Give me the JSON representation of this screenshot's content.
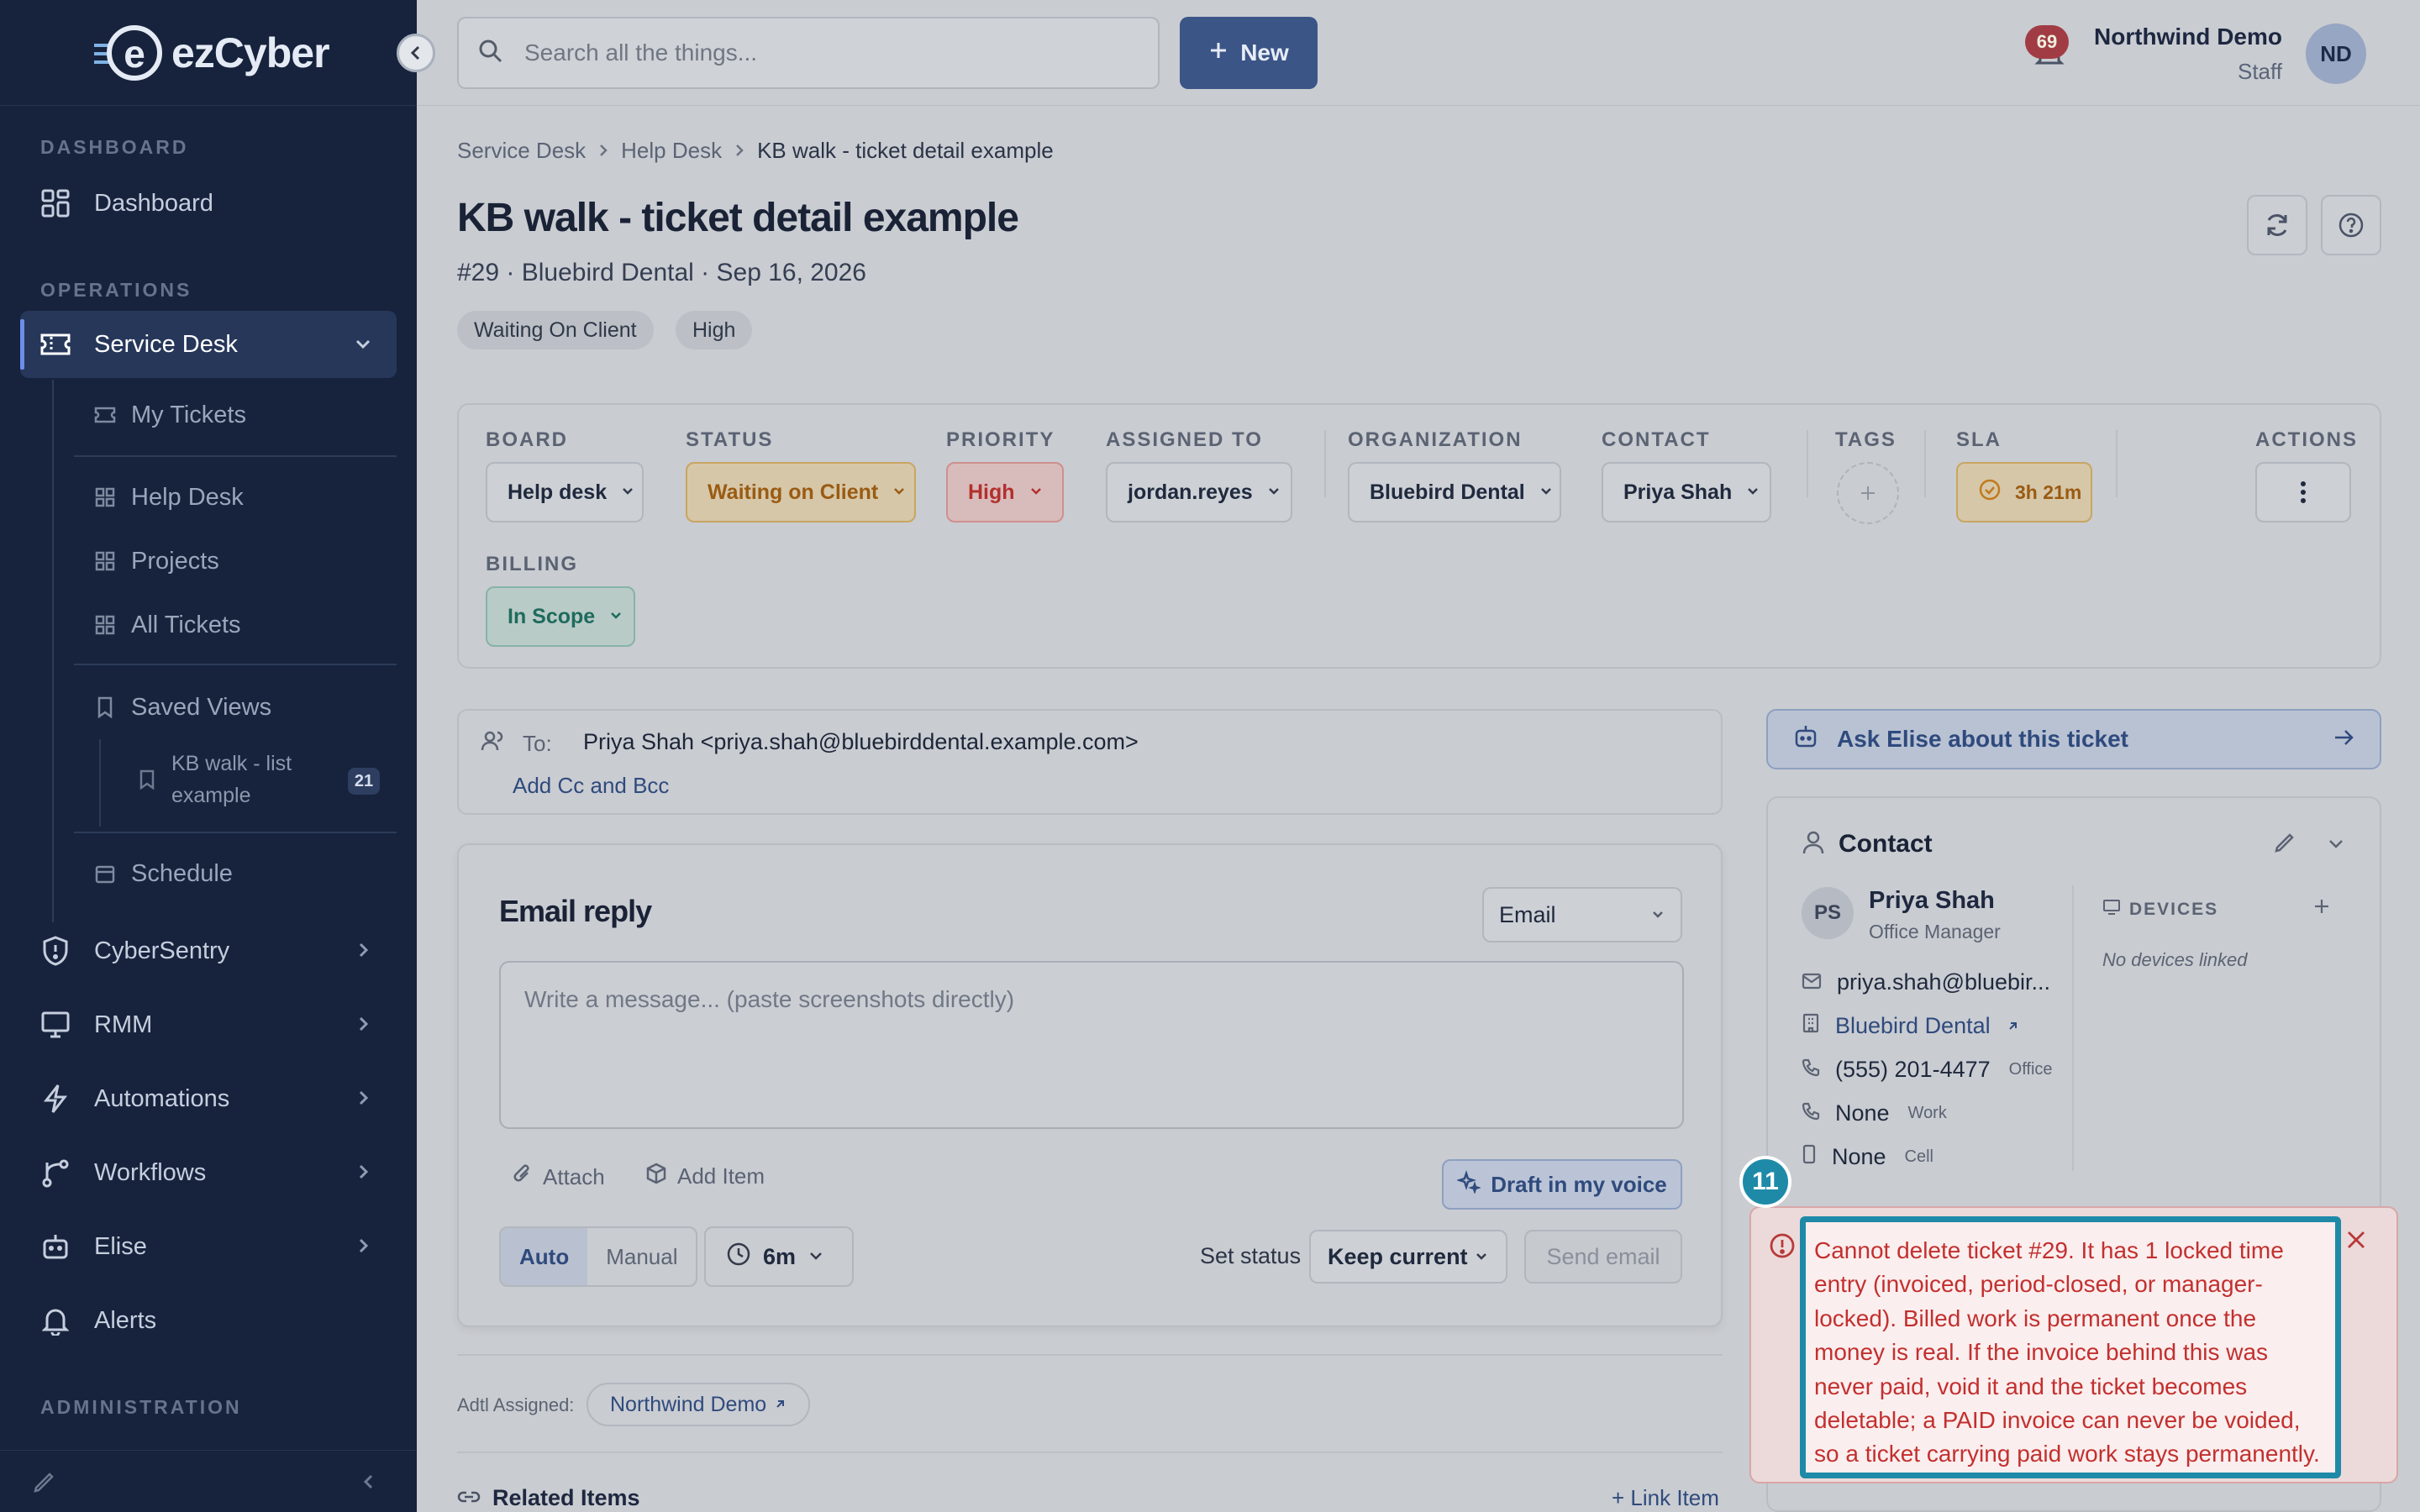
{
  "brand": {
    "name": "ezCyber",
    "logo_letter": "e"
  },
  "sidebar": {
    "sections": {
      "dashboard": "DASHBOARD",
      "operations": "OPERATIONS",
      "administration": "ADMINISTRATION"
    },
    "items": {
      "dashboard": "Dashboard",
      "service_desk": "Service Desk",
      "my_tickets": "My Tickets",
      "help_desk": "Help Desk",
      "projects": "Projects",
      "all_tickets": "All Tickets",
      "saved_views": "Saved Views",
      "saved_view_item": "KB walk - list example",
      "saved_view_count": "21",
      "schedule": "Schedule",
      "cybersentry": "CyberSentry",
      "rmm": "RMM",
      "automations": "Automations",
      "workflows": "Workflows",
      "elise": "Elise",
      "alerts": "Alerts"
    }
  },
  "topbar": {
    "search_placeholder": "Search all the things...",
    "new_label": "New",
    "notification_count": "69",
    "user_name": "Northwind Demo",
    "user_role": "Staff",
    "user_initials": "ND"
  },
  "breadcrumb": [
    "Service Desk",
    "Help Desk",
    "KB walk - ticket detail example"
  ],
  "ticket": {
    "title": "KB walk - ticket detail example",
    "meta": "#29 · Bluebird Dental · Sep 16, 2026",
    "badges": [
      "Waiting On Client",
      "High"
    ]
  },
  "properties": {
    "board": {
      "label": "BOARD",
      "value": "Help desk"
    },
    "status": {
      "label": "STATUS",
      "value": "Waiting on Client"
    },
    "priority": {
      "label": "PRIORITY",
      "value": "High"
    },
    "assigned": {
      "label": "ASSIGNED TO",
      "value": "jordan.reyes"
    },
    "organization": {
      "label": "ORGANIZATION",
      "value": "Bluebird Dental"
    },
    "contact": {
      "label": "CONTACT",
      "value": "Priya Shah"
    },
    "tags": {
      "label": "TAGS"
    },
    "sla": {
      "label": "SLA",
      "value": "3h 21m"
    },
    "actions": {
      "label": "ACTIONS"
    },
    "billing": {
      "label": "BILLING",
      "value": "In Scope"
    }
  },
  "recipients": {
    "to_label": "To:",
    "to_value": "Priya Shah <priya.shah@bluebirddental.example.com>",
    "cc_link": "Add Cc and Bcc"
  },
  "reply": {
    "title": "Email reply",
    "channel": "Email",
    "placeholder": "Write a message... (paste screenshots directly)",
    "attach": "Attach",
    "add_item": "Add Item",
    "draft": "Draft in my voice",
    "mode_auto": "Auto",
    "mode_manual": "Manual",
    "time": "6m",
    "set_status_label": "Set status",
    "set_status_value": "Keep current",
    "send": "Send email"
  },
  "additional": {
    "label": "Adtl Assigned:",
    "value": "Northwind Demo"
  },
  "related": {
    "title": "Related Items",
    "link": "+ Link Item"
  },
  "elise": {
    "label": "Ask Elise about this ticket"
  },
  "contact_card": {
    "title": "Contact",
    "initials": "PS",
    "name": "Priya Shah",
    "role": "Office Manager",
    "email": "priya.shah@bluebir...",
    "org": "Bluebird Dental",
    "phone": "(555) 201-4477",
    "phone_type": "Office",
    "work": "None",
    "work_type": "Work",
    "cell": "None",
    "cell_type": "Cell",
    "devices_label": "DEVICES",
    "devices_empty": "No devices linked"
  },
  "tour": {
    "step": "11"
  },
  "toast": {
    "message": "Cannot delete ticket #29. It has 1 locked time entry (invoiced, period-closed, or manager-locked). Billed work is permanent once the money is real. If the invoice behind this was never paid, void it and the ticket becomes deletable; a PAID invoice can never be voided, so a ticket carrying paid work stays permanently."
  },
  "colors": {
    "sidebar_bg": "#17233d",
    "accent": "#3b5587",
    "error": "#c2302f",
    "tour": "#1e8aa8"
  }
}
